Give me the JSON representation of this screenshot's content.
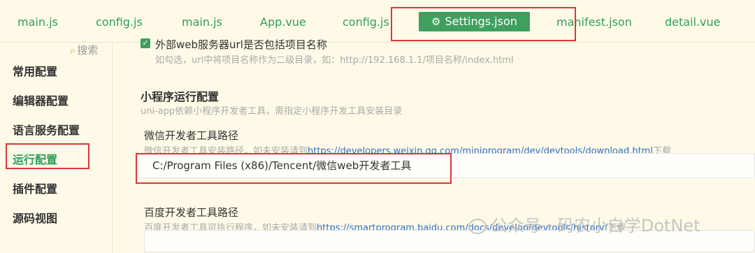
{
  "tabs": [
    {
      "label": "main.js"
    },
    {
      "label": "config.js"
    },
    {
      "label": "main.js"
    },
    {
      "label": "App.vue"
    },
    {
      "label": "config.js"
    },
    {
      "label": "Settings.json",
      "active": true
    },
    {
      "label": "manifest.json"
    },
    {
      "label": "detail.vue"
    }
  ],
  "sidebar": {
    "search_label": "搜索",
    "items": [
      {
        "label": "常用配置"
      },
      {
        "label": "编辑器配置"
      },
      {
        "label": "语言服务配置"
      },
      {
        "label": "运行配置",
        "active": true
      },
      {
        "label": "插件配置"
      },
      {
        "label": "源码视图"
      }
    ]
  },
  "main": {
    "external_server": {
      "checked": true,
      "label": "外部web服务器url是否包括项目名称",
      "desc": "如勾选，url中将项目名称作为二级目录，如：http://192.168.1.1/项目名称/index.html"
    },
    "miniprogram": {
      "title": "小程序运行配置",
      "desc": "uni-app依赖小程序开发者工具，需指定小程序开发工具安装目录"
    },
    "wechat": {
      "label": "微信开发者工具路径",
      "desc_prefix": "微信开发者工具安装路径，如未安装请到",
      "link": "https://developers.weixin.qq.com/miniprogram/dev/devtools/download.html",
      "desc_suffix": "下载",
      "value": "C:/Program Files (x86)/Tencent/微信web开发者工具"
    },
    "baidu": {
      "label": "百度开发者工具路径",
      "desc_prefix": "百度开发者工具可执行程序，如未安装请到",
      "link": "https://smartprogram.baidu.com/docs/develop/devtools/history/",
      "desc_suffix": "下载",
      "value": ""
    }
  },
  "watermark": "公众号 · 码农小白学DotNet",
  "colors": {
    "background": "#fffae8",
    "accent_green": "#3f9f5f",
    "link_blue": "#2c6fc9",
    "highlight_red": "#d9383a"
  }
}
